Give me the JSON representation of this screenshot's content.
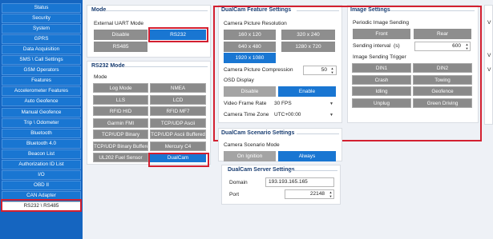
{
  "sidebar": {
    "items": [
      {
        "label": "Status"
      },
      {
        "label": "Security"
      },
      {
        "label": "System"
      },
      {
        "label": "GPRS"
      },
      {
        "label": "Data Acquisition"
      },
      {
        "label": "SMS \\ Call Settings"
      },
      {
        "label": "GSM Operators"
      },
      {
        "label": "Features"
      },
      {
        "label": "Accelerometer Features"
      },
      {
        "label": "Auto Geofence"
      },
      {
        "label": "Manual Geofence"
      },
      {
        "label": "Trip \\ Odometer"
      },
      {
        "label": "Bluetooth"
      },
      {
        "label": "Bluetooth 4.0"
      },
      {
        "label": "Beacon List"
      },
      {
        "label": "Authorization ID List"
      },
      {
        "label": "I/O"
      },
      {
        "label": "OBD II"
      },
      {
        "label": "CAN Adapter"
      },
      {
        "label": "RS232 \\ RS485"
      }
    ]
  },
  "mode": {
    "title": "Mode",
    "uart_label": "External UART Mode",
    "options": [
      "Disable",
      "RS232",
      "RS485"
    ],
    "selected": "RS232"
  },
  "rs232": {
    "title": "RS232 Mode",
    "mode_label": "Mode",
    "options": [
      [
        "Log Mode",
        "NMEA"
      ],
      [
        "LLS",
        "LCD"
      ],
      [
        "RFID HID",
        "RFID MF7"
      ],
      [
        "Garmin FMI",
        "TCP/UDP Ascii"
      ],
      [
        "TCP/UDP Binary",
        "TCP/UDP Ascii Buffered"
      ],
      [
        "TCP/UDP Binary Buffered",
        "Mercury C4"
      ],
      [
        "UL202 Fuel Sensor",
        "DualCam"
      ]
    ],
    "selected": "DualCam"
  },
  "dualcam": {
    "title": "DualCam Feature Settings",
    "resolution_label": "Camera Picture Resolution",
    "resolutions": [
      [
        "160 x 120",
        "320 x 240"
      ],
      [
        "640 x 480",
        "1280 x 720"
      ],
      [
        "1920 x 1080"
      ]
    ],
    "resolution_selected": "1920 x 1080",
    "compression_label": "Camera Picture Compression",
    "compression_value": "50",
    "osd_label": "OSD Display",
    "osd_options": [
      "Disable",
      "Enable"
    ],
    "osd_selected": "Enable",
    "frame_rate_label": "Video Frame Rate",
    "frame_rate_value": "30 FPS",
    "timezone_label": "Camera Time Zone",
    "timezone_value": "UTC+00:00"
  },
  "image": {
    "title": "Image Settings",
    "periodic_label": "Periodic Image Sending",
    "cameras": [
      "Front",
      "Rear"
    ],
    "interval_label": "Sending interval",
    "interval_unit": "(s)",
    "interval_value": "600",
    "trigger_label": "Image Sending Trigger",
    "triggers": [
      [
        "DIN1",
        "DIN2"
      ],
      [
        "Crash",
        "Towing"
      ],
      [
        "Idling",
        "Geofence"
      ],
      [
        "Unplug",
        "Green Driving"
      ]
    ]
  },
  "scenario": {
    "title": "DualCam Scenario Settings",
    "mode_label": "Camera Scenario Mode",
    "options": [
      "On Ignition",
      "Always"
    ],
    "selected": "Always"
  },
  "server": {
    "title": "DualCam Server Settings",
    "domain_label": "Domain",
    "domain_value": "193.193.165.165",
    "port_label": "Port",
    "port_value": "22148"
  },
  "partial": {
    "letters": [
      "V",
      "V",
      "V"
    ]
  },
  "colors": {
    "accent": "#1976d2",
    "sidebar": "#1565c0",
    "highlight": "#d32030",
    "option": "#8e8e8e"
  }
}
